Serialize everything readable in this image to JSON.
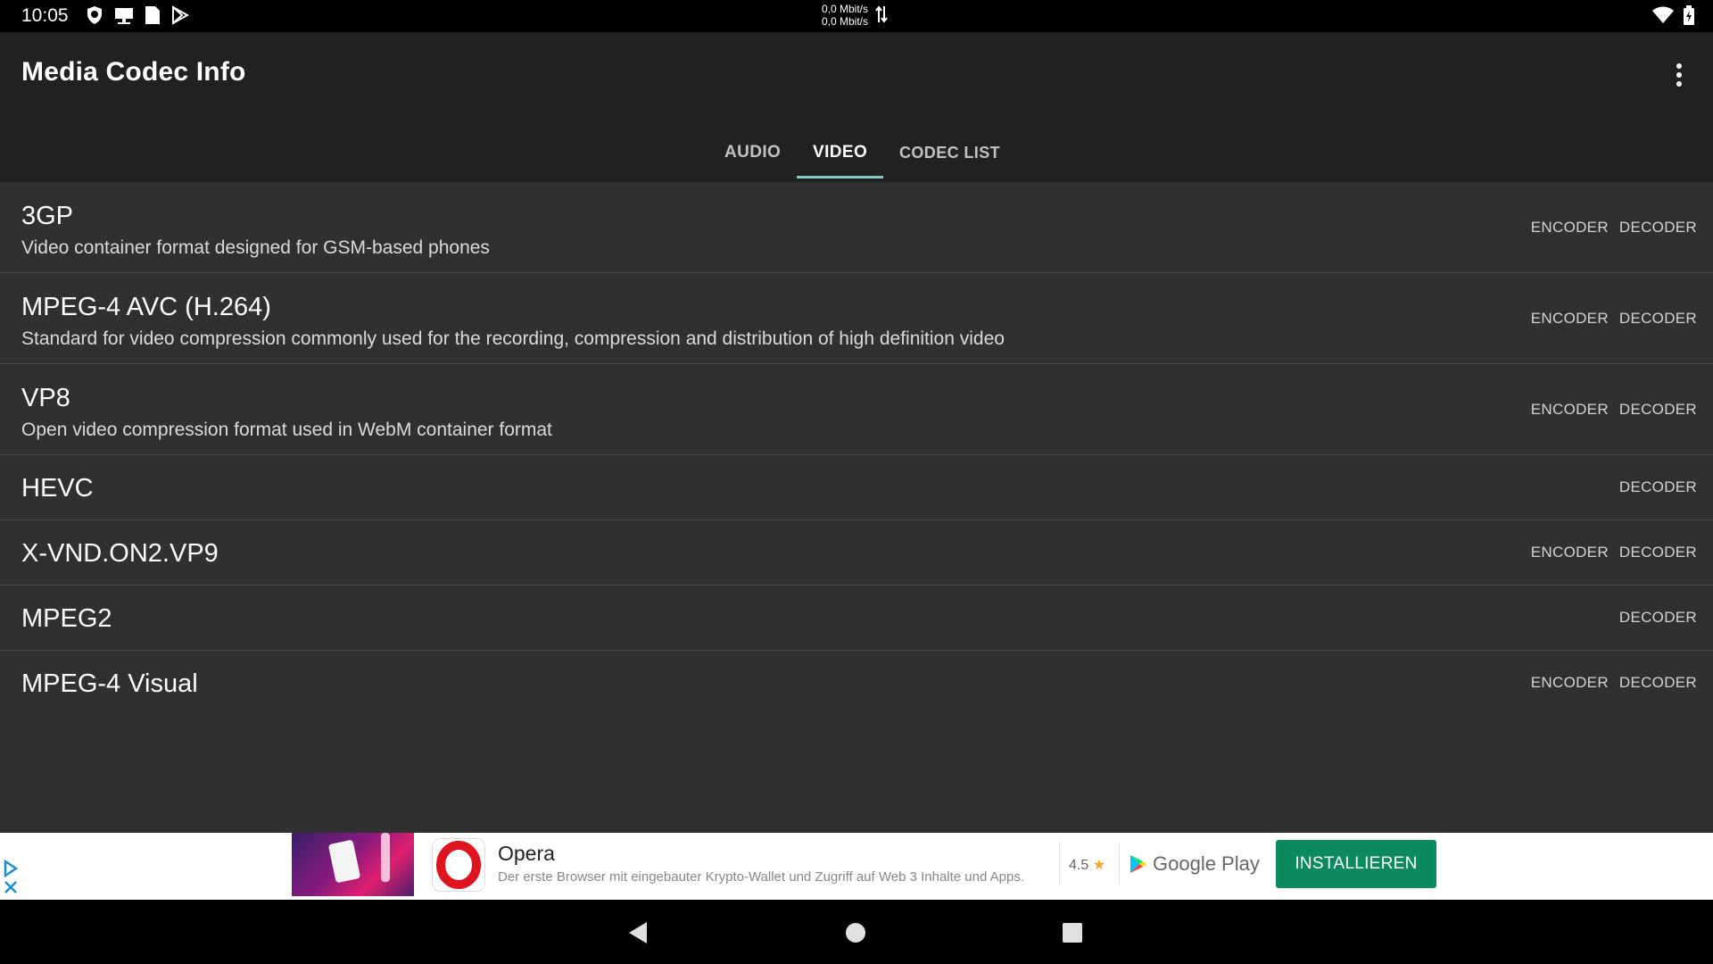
{
  "status_bar": {
    "time": "10:05",
    "net_up": "0,0 Mbit/s",
    "net_down": "0,0 Mbit/s",
    "left_icons": [
      "shield-icon",
      "desktop-icon",
      "file-icon",
      "play-store-icon"
    ],
    "right_icons": [
      "wifi-icon",
      "battery-icon"
    ]
  },
  "app": {
    "title": "Media Codec Info",
    "tabs": [
      {
        "label": "AUDIO",
        "active": false
      },
      {
        "label": "VIDEO",
        "active": true
      },
      {
        "label": "CODEC LIST",
        "active": false
      }
    ],
    "accent_color": "#80cbc4"
  },
  "codecs": [
    {
      "name": "3GP",
      "description": "Video container format designed for GSM-based phones",
      "encoder": "ENCODER",
      "decoder": "DECODER"
    },
    {
      "name": "MPEG-4 AVC (H.264)",
      "description": "Standard for video compression commonly used for the recording, compression and distribution of high definition video",
      "encoder": "ENCODER",
      "decoder": "DECODER"
    },
    {
      "name": "VP8",
      "description": "Open video compression format used in WebM container format",
      "encoder": "ENCODER",
      "decoder": "DECODER"
    },
    {
      "name": "HEVC",
      "description": "",
      "encoder": "",
      "decoder": "DECODER"
    },
    {
      "name": "X-VND.ON2.VP9",
      "description": "",
      "encoder": "ENCODER",
      "decoder": "DECODER"
    },
    {
      "name": "MPEG2",
      "description": "",
      "encoder": "",
      "decoder": "DECODER"
    },
    {
      "name": "MPEG-4 Visual",
      "description": "",
      "encoder": "ENCODER",
      "decoder": "DECODER"
    }
  ],
  "ad": {
    "app_name": "Opera",
    "description": "Der erste Browser mit eingebauter Krypto-Wallet und Zugriff auf Web 3 Inhalte und Apps.",
    "rating": "4.5",
    "store": "Google Play",
    "install_label": "INSTALLIEREN",
    "install_color": "#0a8a5e"
  },
  "nav": {
    "buttons": [
      "back-icon",
      "home-icon",
      "recents-icon"
    ]
  }
}
